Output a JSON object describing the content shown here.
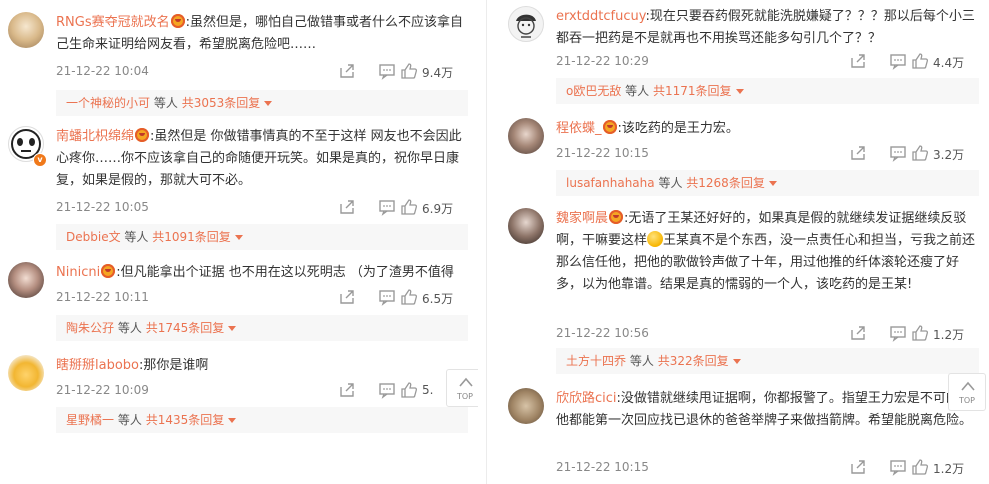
{
  "left_column": [
    {
      "username": "RNGs赛夺冠就改名",
      "text": ":虽然但是，哪怕自己做错事或者什么不应该拿自己生命来证明给网友看，希望脱离危险吧……",
      "time": "21-12-22 10:04",
      "likes": "9.4万",
      "reply_user": "一个神秘的小可",
      "reply_mid": "等人",
      "reply_total": "共3053条回复"
    },
    {
      "username": "南蟠北枳绵绵",
      "text": ":虽然但是 你做错事情真的不至于这样 网友也不会因此心疼你……你不应该拿自己的命随便开玩笑。如果是真的，祝你早日康复，如果是假的，那就大可不必。",
      "time": "21-12-22 10:05",
      "likes": "6.9万",
      "reply_user": "Debbie文",
      "reply_mid": "等人",
      "reply_total": "共1091条回复"
    },
    {
      "username": "Ninicni",
      "text": ":但凡能拿出个证据 也不用在这以死明志 （为了渣男不值得",
      "time": "21-12-22 10:11",
      "likes": "6.5万",
      "reply_user": "陶朱公孖",
      "reply_mid": "等人",
      "reply_total": "共1745条回复"
    },
    {
      "username": "瞎掰掰labobo",
      "text": ":那你是谁啊",
      "time": "21-12-22 10:09",
      "likes": "5.",
      "reply_user": "星野橘一",
      "reply_mid": "等人",
      "reply_total": "共1435条回复"
    }
  ],
  "right_column": [
    {
      "username": "erxtddtcfucuy",
      "text": ":现在只要吞药假死就能洗脱嫌疑了？？？那以后每个小三都吞一把药是不是就再也不用挨骂还能多勾引几个了？？",
      "time": "21-12-22 10:29",
      "likes": "4.4万",
      "reply_user": "o欧巴无敌",
      "reply_mid": "等人",
      "reply_total": "共1171条回复"
    },
    {
      "username": "程依蝶_",
      "text": ":该吃药的是王力宏。",
      "time": "21-12-22 10:15",
      "likes": "3.2万",
      "reply_user": "lusafanhahaha",
      "reply_mid": "等人",
      "reply_total": "共1268条回复"
    },
    {
      "username": "魏家啊晨",
      "text_a": ":无语了王某还好好的，如果真是假的就继续发证据继续反驳啊，干嘛要这样",
      "text_b": "王某真不是个东西，没一点责任心和担当，亏我之前还那么信任他，把他的歌做铃声做了十年，用过他推的纤体滚轮还瘦了好多，以为他靠谱。结果是真的懦弱的一个人，该吃药的是王某!",
      "time": "21-12-22 10:56",
      "likes": "1.2万",
      "reply_user": "土方十四乔",
      "reply_mid": "等人",
      "reply_total": "共322条回复"
    },
    {
      "username": "欣欣路cici",
      "text": ":没做错就继续甩证据啊，你都报警了。指望王力宏是不可的，他都能第一次回应找已退休的爸爸举牌子来做挡箭牌。希望能脱离危险。",
      "time": "21-12-22 10:15",
      "likes": "1.2万"
    }
  ],
  "top_button_label": "TOP",
  "colors": {
    "username": "#eb7350",
    "text": "#333333",
    "meta": "#888888",
    "reply_bg": "#f7f7f7"
  }
}
